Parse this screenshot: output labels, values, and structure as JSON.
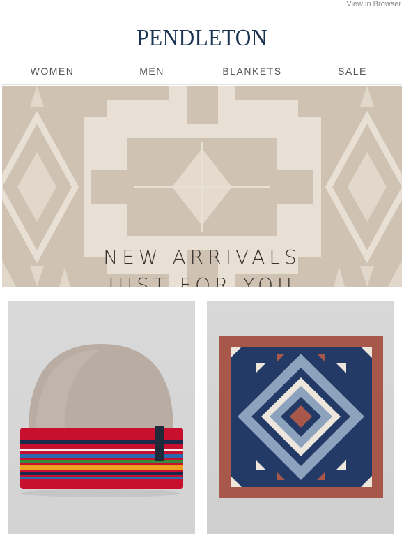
{
  "header": {
    "view_in_browser": "View in Browser",
    "logo_text": "PENDLETON"
  },
  "nav": {
    "items": [
      {
        "label": "WOMEN"
      },
      {
        "label": "MEN"
      },
      {
        "label": "BLANKETS"
      },
      {
        "label": "SALE"
      }
    ]
  },
  "hero": {
    "line1": "NEW ARRIVALS",
    "line2": "JUST FOR YOU",
    "colors": {
      "base": "#cfc2b3",
      "pattern": "#e9e1d6"
    }
  },
  "products": [
    {
      "name": "striped-beanie",
      "colors": [
        "#b9ada3",
        "#c8102e",
        "#1b2a4a",
        "#f0a020",
        "#3a8a3a",
        "#2a6ab0"
      ]
    },
    {
      "name": "patterned-bandana",
      "colors": [
        "#a8584a",
        "#233a66",
        "#8da2bd",
        "#ece6dc"
      ]
    }
  ]
}
